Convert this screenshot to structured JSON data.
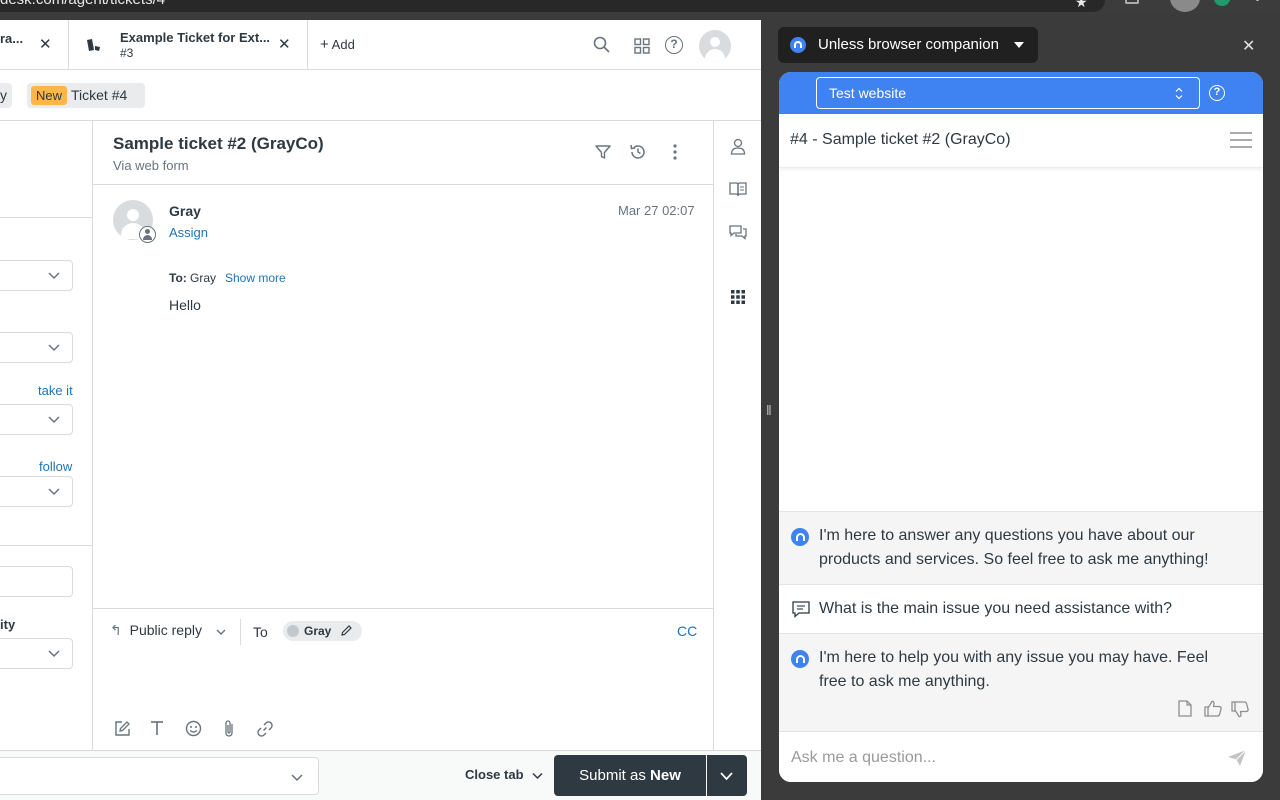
{
  "browser": {
    "url_fragment": "desk.com/agent/tickets/4"
  },
  "tabs": [
    {
      "title": "ra...",
      "subtitle": ""
    },
    {
      "title": "Example Ticket for Ext...",
      "subtitle": "#3"
    }
  ],
  "add_tab_label": "Add",
  "subbar": {
    "new_badge": "New",
    "ticket_label": "Ticket #4",
    "prev_crumb": "y"
  },
  "props": {
    "take_it": "take it",
    "follow": "follow",
    "priority_label": "ity"
  },
  "ticket": {
    "title": "Sample ticket #2 (GrayCo)",
    "via": "Via web form",
    "message": {
      "author": "Gray",
      "assign": "Assign",
      "timestamp": "Mar 27 02:07",
      "to_label": "To:",
      "to_value": "Gray",
      "show_more": "Show more",
      "body": "Hello"
    }
  },
  "composer": {
    "mode": "Public reply",
    "to_label": "To",
    "recipient": "Gray",
    "cc": "CC"
  },
  "footer": {
    "close_tab": "Close tab",
    "submit_prefix": "Submit as ",
    "submit_status": "New"
  },
  "companion": {
    "title": "Unless browser companion",
    "site": "Test website",
    "ticket_heading": "#4 - Sample ticket #2 (GrayCo)",
    "messages": [
      {
        "kind": "bot",
        "text": "I'm here to answer any questions you have about our products and services. So feel free to ask me anything!"
      },
      {
        "kind": "question",
        "text": "What is the main issue you need assistance with?"
      },
      {
        "kind": "bot",
        "text": "I'm here to help you with any issue you may have. Feel free to ask me anything."
      }
    ],
    "input_placeholder": "Ask me a question..."
  },
  "colors": {
    "accent_blue": "#3f82f2",
    "link_blue": "#1f73b7",
    "badge_new": "#ffb648",
    "dark_button": "#2f3941"
  }
}
